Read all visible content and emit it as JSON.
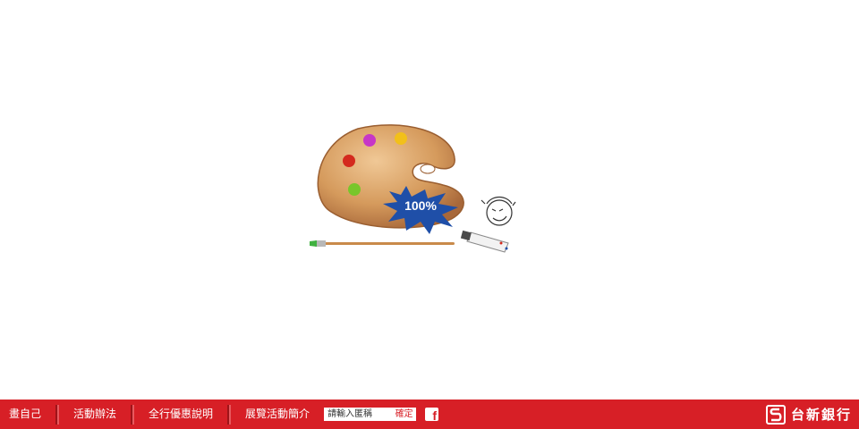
{
  "loader": {
    "progress_text": "100%"
  },
  "footer": {
    "nav": [
      {
        "label": "畫自己"
      },
      {
        "label": "活動辦法"
      },
      {
        "label": "全行優惠說明"
      },
      {
        "label": "展覽活動簡介"
      }
    ],
    "search": {
      "placeholder": "請輸入匿稱",
      "button_label": "確定"
    },
    "facebook_glyph": "f",
    "brand_name": "台新銀行"
  },
  "colors": {
    "footer_bg": "#d71f26",
    "splash_blue": "#1f4fa8",
    "palette_wood": "#d59a5c"
  },
  "icons": [
    "palette-icon",
    "paintbrush-icon",
    "paint-tube-icon",
    "sketch-face-icon",
    "facebook-icon",
    "taishin-logo-icon"
  ]
}
